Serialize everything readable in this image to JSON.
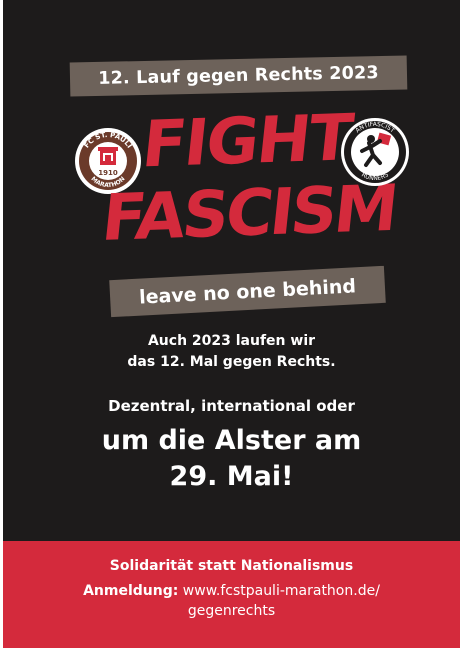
{
  "poster": {
    "banner_top": "12. Lauf gegen Rechts 2023",
    "logo_left_text": "FC ST. PAULI 1910 MARATHON",
    "logo_right_text": "ANTIFASCIST RUNNERS",
    "headline_line1": "FIGHT",
    "headline_line2": "FASCISM",
    "tagline": "leave no one behind",
    "intro_line1": "Auch 2023 laufen wir",
    "intro_line2": "das 12. Mal gegen Rechts.",
    "dezentral": "Dezentral, international oder",
    "alster_line1": "um die Alster am",
    "alster_line2": "29. Mai!",
    "footer_line1": "Solidarität statt Nationalismus",
    "footer_label": "Anmeldung:",
    "footer_url_line1": "www.fcstpauli-marathon.de/",
    "footer_url_line2": "gegenrechts"
  },
  "colors": {
    "background": "#1d1b1b",
    "accent_red": "#d42a3c",
    "banner_brown": "#6d625a",
    "text": "#ffffff"
  }
}
